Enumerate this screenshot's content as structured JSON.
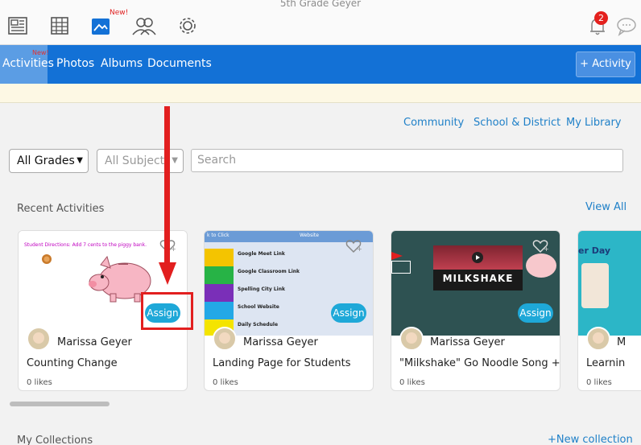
{
  "window": {
    "title": "5th Grade Geyer"
  },
  "topbar": {
    "icons": [
      "newspaper-icon",
      "calendar-grid-icon",
      "photos-icon",
      "people-icon",
      "gear-icon",
      "bell-icon",
      "chat-icon"
    ],
    "new_badge": "New!",
    "notification_count": "2"
  },
  "nav": {
    "tabs": [
      {
        "label": "Activities",
        "active": true
      },
      {
        "label": "Photos"
      },
      {
        "label": "Albums"
      },
      {
        "label": "Documents"
      }
    ],
    "activities_new": "New!",
    "add_button": "+ Activity"
  },
  "filters": {
    "links": [
      "Community",
      "School & District",
      "My Library"
    ],
    "grade": "All Grades",
    "subject": "All Subjects",
    "search_placeholder": "Search"
  },
  "recent": {
    "title": "Recent Activities",
    "view_all": "View All",
    "cards": [
      {
        "author": "Marissa Geyer",
        "title": "Counting Change",
        "likes": "0 likes",
        "assign": "Assign",
        "caption": "Student Directions: Add 7 cents to the piggy bank."
      },
      {
        "author": "Marissa Geyer",
        "title": "Landing Page for Students",
        "likes": "0 likes",
        "assign": "Assign",
        "rows": [
          "Google Meet Link",
          "Google Classroom Link",
          "Spelling City Link",
          "School Website",
          "Daily Schedule"
        ],
        "header_left": "k to Click",
        "header_right": "Website"
      },
      {
        "author": "Marissa Geyer",
        "title": "\"Milkshake\" Go Noodle Song + ...",
        "likes": "0 likes",
        "assign": "Assign",
        "overlay": "MILKSHAKE"
      },
      {
        "author": "M",
        "title": "Learnin",
        "likes": "0 likes",
        "banner": "er Day"
      }
    ]
  },
  "collections": {
    "title": "My Collections",
    "new_link": "+New collection"
  },
  "colors": {
    "nav_blue": "#1371d6",
    "assign": "#1ea8d8",
    "link": "#1f80c8",
    "annotation_red": "#e21f1f"
  }
}
